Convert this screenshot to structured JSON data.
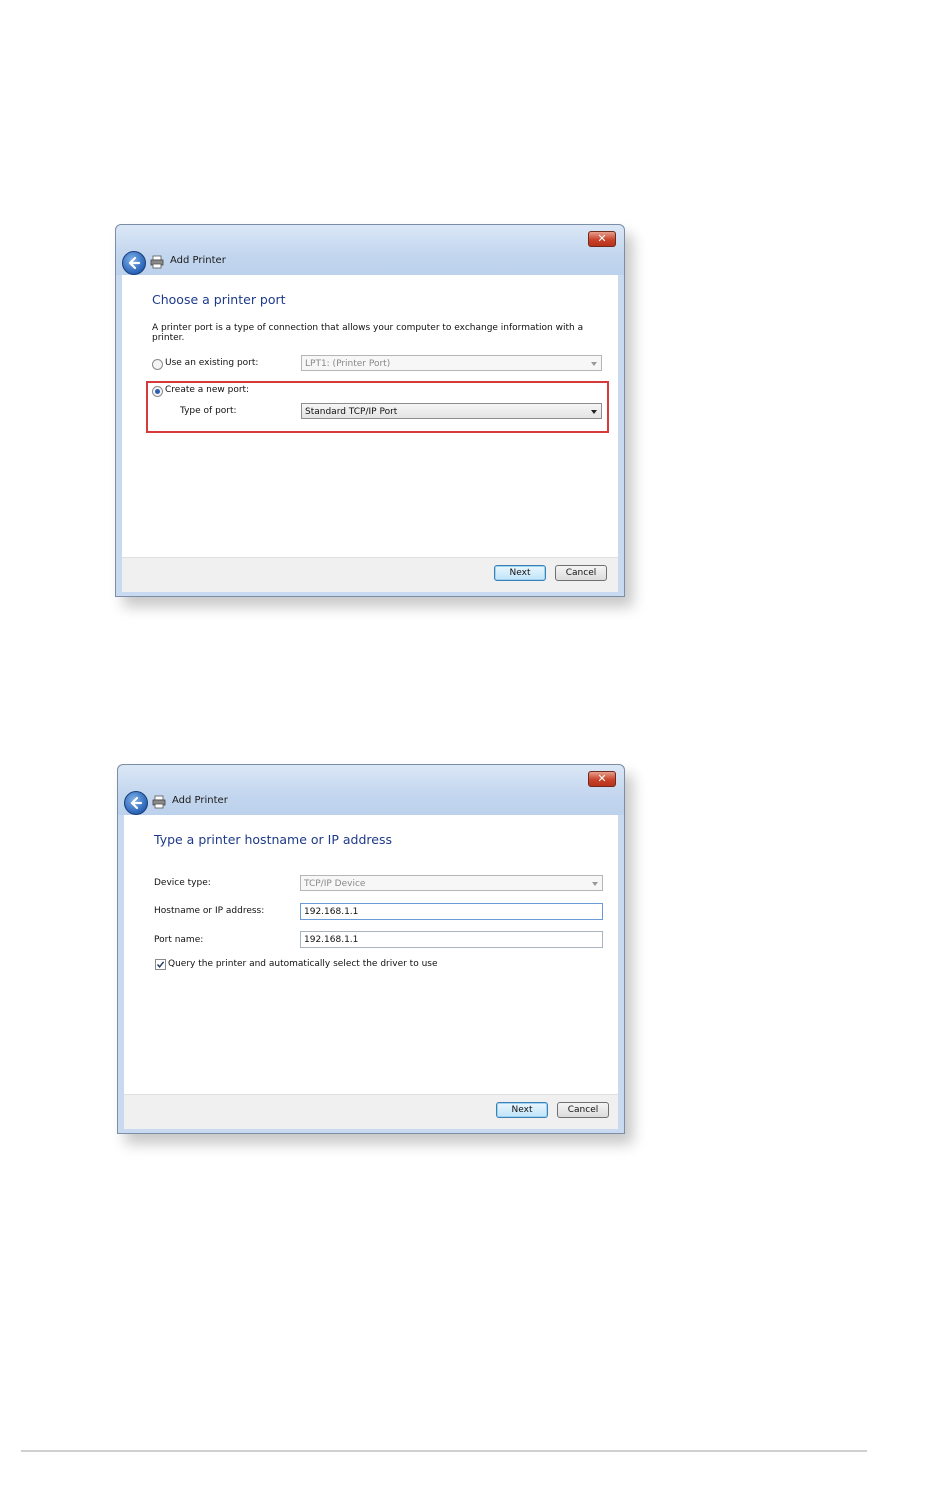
{
  "dialog1": {
    "title": "Add Printer",
    "close_label": "✕",
    "heading": "Choose a printer port",
    "description": "A printer port is a type of connection that allows your computer to exchange information with a printer.",
    "existing_port": {
      "label": "Use an existing port:",
      "selected": false,
      "value": "LPT1: (Printer Port)"
    },
    "new_port": {
      "label": "Create a new port:",
      "selected": true
    },
    "type_of_port": {
      "label": "Type of port:",
      "value": "Standard TCP/IP Port"
    },
    "next_label": "Next",
    "cancel_label": "Cancel",
    "highlight_color": "#d63a3a"
  },
  "dialog2": {
    "title": "Add Printer",
    "close_label": "✕",
    "heading": "Type a printer hostname or IP address",
    "device_type": {
      "label": "Device type:",
      "value": "TCP/IP Device"
    },
    "hostname": {
      "label": "Hostname or IP address:",
      "value": "192.168.1.1"
    },
    "port_name": {
      "label": "Port name:",
      "value": "192.168.1.1"
    },
    "query_checkbox": {
      "label": "Query the printer and automatically select the driver to use",
      "checked": true
    },
    "next_label": "Next",
    "cancel_label": "Cancel"
  }
}
